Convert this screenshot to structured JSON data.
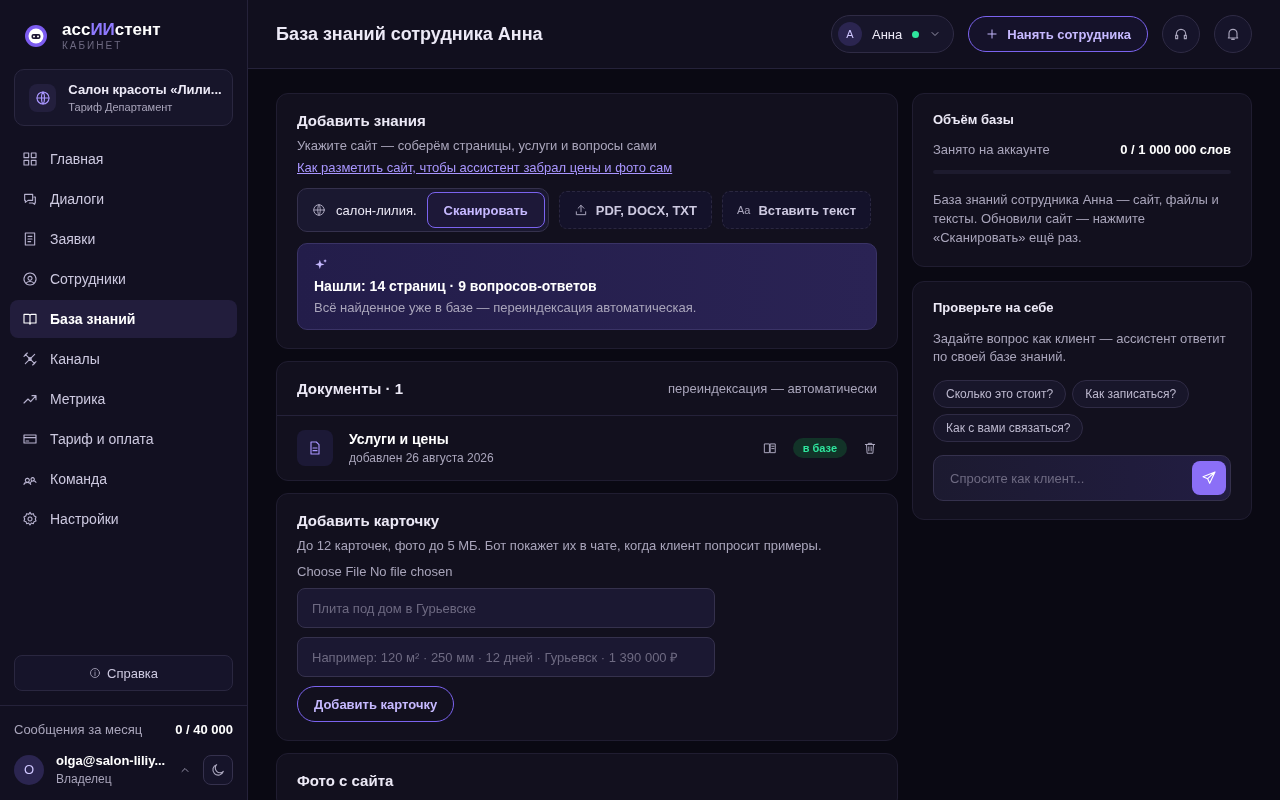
{
  "brand": {
    "name_start": "асс",
    "name_accent": "ИИ",
    "name_end": "стент",
    "subtitle": "КАБИНЕТ"
  },
  "workspace": {
    "name": "Салон красоты «Лили...",
    "plan": "Тариф Департамент"
  },
  "sidebar": {
    "items": [
      {
        "label": "Главная",
        "selected": false
      },
      {
        "label": "Диалоги",
        "selected": false
      },
      {
        "label": "Заявки",
        "selected": false
      },
      {
        "label": "Сотрудники",
        "selected": false
      },
      {
        "label": "База знаний",
        "selected": true
      },
      {
        "label": "Каналы",
        "selected": false
      },
      {
        "label": "Метрика",
        "selected": false
      },
      {
        "label": "Тариф и оплата",
        "selected": false
      },
      {
        "label": "Команда",
        "selected": false
      },
      {
        "label": "Настройки",
        "selected": false
      }
    ],
    "help": "Справка",
    "usage_label": "Сообщения за месяц",
    "usage_value": "0 / 40 000",
    "user": {
      "initial": "O",
      "email": "olga@salon-liliy...",
      "role": "Владелец"
    }
  },
  "header": {
    "title": "База знаний сотрудника Анна",
    "employee": {
      "initial": "А",
      "name": "Анна",
      "online": true
    },
    "hire_button": "Нанять сотрудника"
  },
  "add_knowledge": {
    "title": "Добавить знания",
    "subtitle": "Укажите сайт — соберём страницы, услуги и вопросы сами",
    "link": "Как разметить сайт, чтобы ассистент забрал цены и фото сам",
    "url_value": "салон-лилия.",
    "scan_button": "Сканировать",
    "upload_button": "PDF, DOCX, TXT",
    "paste_icon": "Aa",
    "paste_button": "Вставить текст",
    "result": {
      "title": "Нашли: 14 страниц · 9 вопросов-ответов",
      "text": "Всё найденное уже в базе — переиндексация автоматическая."
    }
  },
  "documents": {
    "title": "Документы · 1",
    "note": "переиндексация — автоматически",
    "rows": [
      {
        "name": "Услуги и цены",
        "date": "добавлен 26 августа 2026",
        "status": "в базе"
      }
    ]
  },
  "add_card": {
    "title": "Добавить карточку",
    "subtitle": "До 12 карточек, фото до 5 МБ. Бот покажет их в чате, когда клиент попросит примеры.",
    "file_label": "Choose File No file chosen",
    "title_placeholder": "Плита под дом в Гурьевске",
    "details_placeholder": "Например: 120 м² · 250 мм · 12 дней · Гурьевск · 1 390 000 ₽",
    "button": "Добавить карточку"
  },
  "photos": {
    "title": "Фото с сайта"
  },
  "volume": {
    "title": "Объём базы",
    "label": "Занято на аккаунте",
    "value": "0 / 1 000 000 слов",
    "level": 0,
    "text": "База знаний сотрудника Анна — сайт, файлы и тексты. Обновили сайт — нажмите «Сканировать» ещё раз."
  },
  "test": {
    "title": "Проверьте на себе",
    "text": "Задайте вопрос как клиент — ассистент ответит по своей базе знаний.",
    "suggestions": [
      "Сколько это стоит?",
      "Как записаться?",
      "Как с вами связаться?"
    ],
    "placeholder": "Спросите как клиент..."
  }
}
